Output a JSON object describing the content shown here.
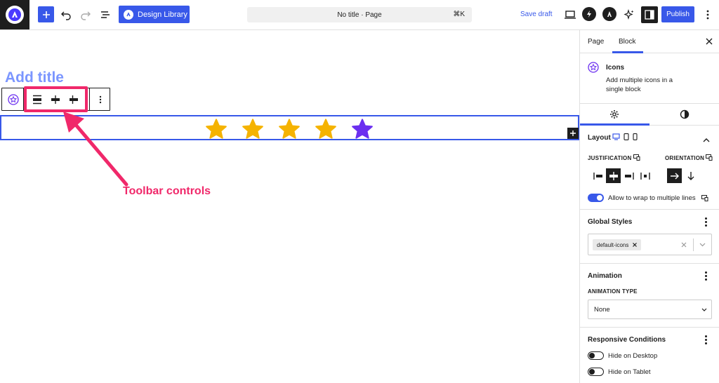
{
  "topbar": {
    "design_library": "Design Library",
    "doc_title": "No title · Page",
    "shortcut": "⌘K",
    "save_draft": "Save draft",
    "publish": "Publish"
  },
  "canvas": {
    "title_placeholder": "Add title",
    "annotation": "Toolbar controls",
    "stars": [
      {
        "color": "#f5b301"
      },
      {
        "color": "#f5b301"
      },
      {
        "color": "#f5b301"
      },
      {
        "color": "#f5b301"
      },
      {
        "color": "#6b2ff0"
      }
    ]
  },
  "sidebar": {
    "tabs": [
      "Page",
      "Block"
    ],
    "block_title": "Icons",
    "block_desc": "Add multiple icons in a single block",
    "layout_label": "Layout",
    "justification_label": "JUSTIFICATION",
    "orientation_label": "ORIENTATION",
    "wrap_label": "Allow to wrap to multiple lines",
    "global_styles_label": "Global Styles",
    "global_style_chip": "default-icons",
    "animation_label": "Animation",
    "animation_type_label": "ANIMATION TYPE",
    "animation_value": "None",
    "responsive_label": "Responsive Conditions",
    "hide_desktop": "Hide on Desktop",
    "hide_tablet": "Hide on Tablet"
  },
  "colors": {
    "accent": "#3858e9",
    "annotation": "#f0286a"
  }
}
